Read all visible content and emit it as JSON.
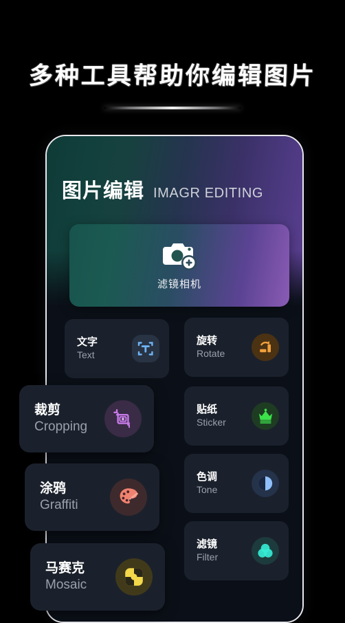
{
  "headline": {
    "text": "多种工具帮助你编辑图片",
    "divider": "silver-gradient-divider"
  },
  "app": {
    "title_cn": "图片编辑",
    "title_en": "IMAGR EDITING",
    "header_gradient_from": "#0f3b37",
    "header_gradient_to": "#5c3f92",
    "body_bg": "#0b1018",
    "card_bg": "#1b212c"
  },
  "featured": {
    "label": "滤镜相机",
    "icon": "camera-plus-icon",
    "gradient_from": "#17544d",
    "gradient_to": "#8a5bb4"
  },
  "tools": [
    {
      "id": "text",
      "label_cn": "文字",
      "label_en": "Text",
      "icon": "text-frame-icon",
      "icon_color": "#6fb4f5",
      "icon_bg": "#283344",
      "size": "small"
    },
    {
      "id": "rotate",
      "label_cn": "旋转",
      "label_en": "Rotate",
      "icon": "rotate-icon",
      "icon_color": "#f2a13c",
      "icon_bg": "#4b3213",
      "size": "small"
    },
    {
      "id": "cropping",
      "label_cn": "裁剪",
      "label_en": "Cropping",
      "icon": "crop-icon",
      "icon_color": "#c77bea",
      "icon_bg": "#3a2b46",
      "size": "large"
    },
    {
      "id": "sticker",
      "label_cn": "贴纸",
      "label_en": "Sticker",
      "icon": "crown-icon",
      "icon_color": "#3ce04a",
      "icon_bg": "#1e3c22",
      "size": "small"
    },
    {
      "id": "graffiti",
      "label_cn": "涂鸦",
      "label_en": "Graffiti",
      "icon": "palette-brush-icon",
      "icon_color": "#f08270",
      "icon_bg": "#3e2a2c",
      "size": "large"
    },
    {
      "id": "tone",
      "label_cn": "色调",
      "label_en": "Tone",
      "icon": "contrast-circle-icon",
      "icon_color": "#5b9bf8",
      "icon_bg": "#24324a",
      "size": "small"
    },
    {
      "id": "filter",
      "label_cn": "滤镜",
      "label_en": "Filter",
      "icon": "three-circles-icon",
      "icon_color": "#35ead4",
      "icon_bg": "#1d3b3c",
      "size": "small"
    },
    {
      "id": "mosaic",
      "label_cn": "马赛克",
      "label_en": "Mosaic",
      "icon": "mosaic-icon",
      "icon_color": "#f2d84a",
      "icon_bg": "#413a1a",
      "size": "large"
    }
  ]
}
